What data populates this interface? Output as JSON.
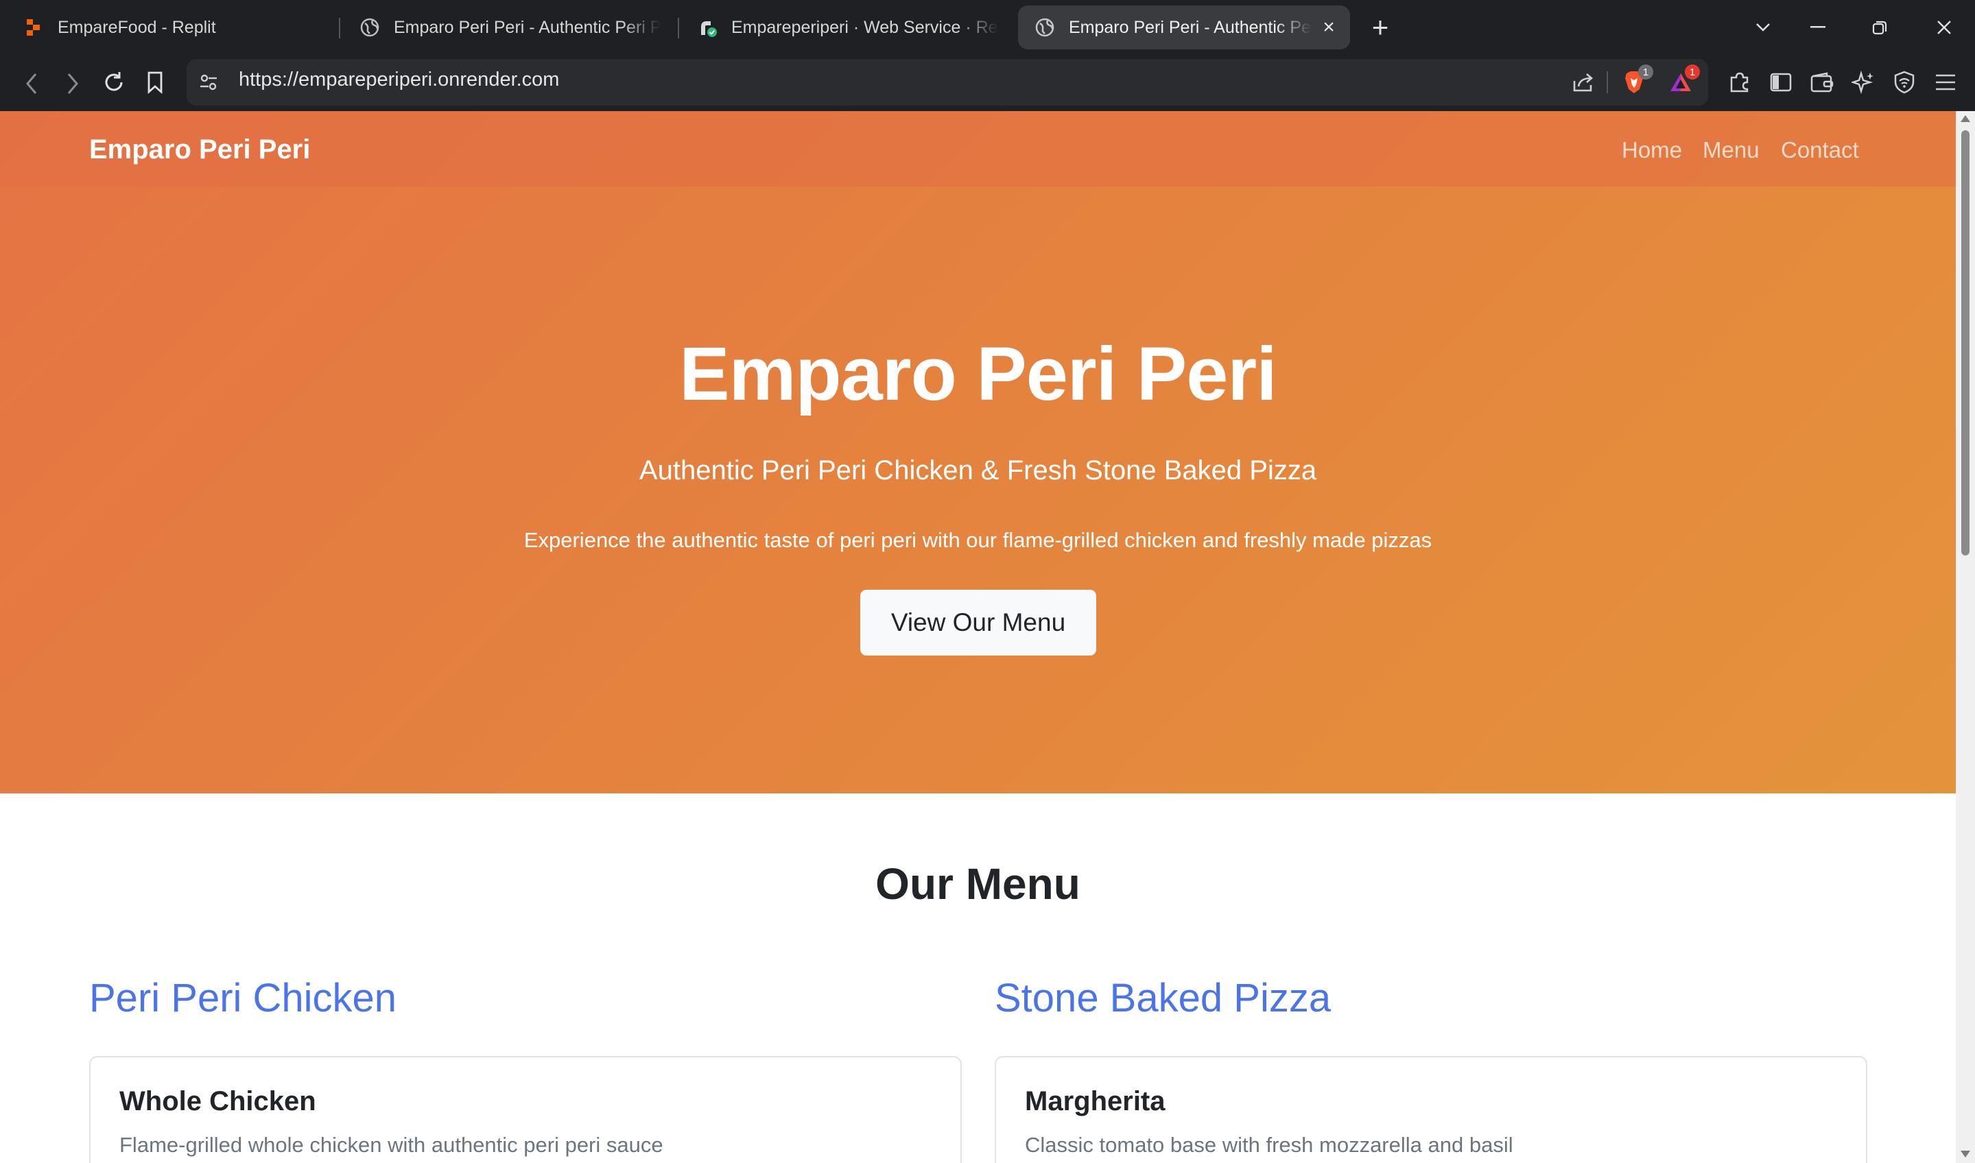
{
  "browser": {
    "tabs": [
      {
        "title": "EmpareFood - Replit",
        "icon": "replit-icon"
      },
      {
        "title": "Emparo Peri Peri - Authentic Peri Peri",
        "icon": "globe-icon"
      },
      {
        "title": "Empareperiperi · Web Service · Render",
        "icon": "render-icon"
      },
      {
        "title": "Emparo Peri Peri - Authentic Peri Peri",
        "icon": "globe-icon",
        "active": true
      }
    ],
    "url": "https://empareperiperi.onrender.com",
    "extension_badges": {
      "brave_shields": "1",
      "rewards": "1"
    }
  },
  "site": {
    "brand": "Emparo Peri Peri",
    "nav": [
      "Home",
      "Menu",
      "Contact"
    ],
    "hero": {
      "title": "Emparo Peri Peri",
      "subtitle": "Authentic Peri Peri Chicken & Fresh Stone Baked Pizza",
      "description": "Experience the authentic taste of peri peri with our flame-grilled chicken and freshly made pizzas",
      "button": "View Our Menu"
    },
    "menu": {
      "heading": "Our Menu",
      "categories": [
        {
          "title": "Peri Peri Chicken",
          "items": [
            {
              "name": "Whole Chicken",
              "description": "Flame-grilled whole chicken with authentic peri peri sauce"
            }
          ]
        },
        {
          "title": "Stone Baked Pizza",
          "items": [
            {
              "name": "Margherita",
              "description": "Classic tomato base with fresh mozzarella and basil"
            }
          ]
        }
      ]
    }
  },
  "colors": {
    "hero_start": "#e57444",
    "hero_end": "#e4933b",
    "category_title": "#4a74e8",
    "chrome_bg": "#1f2023"
  }
}
